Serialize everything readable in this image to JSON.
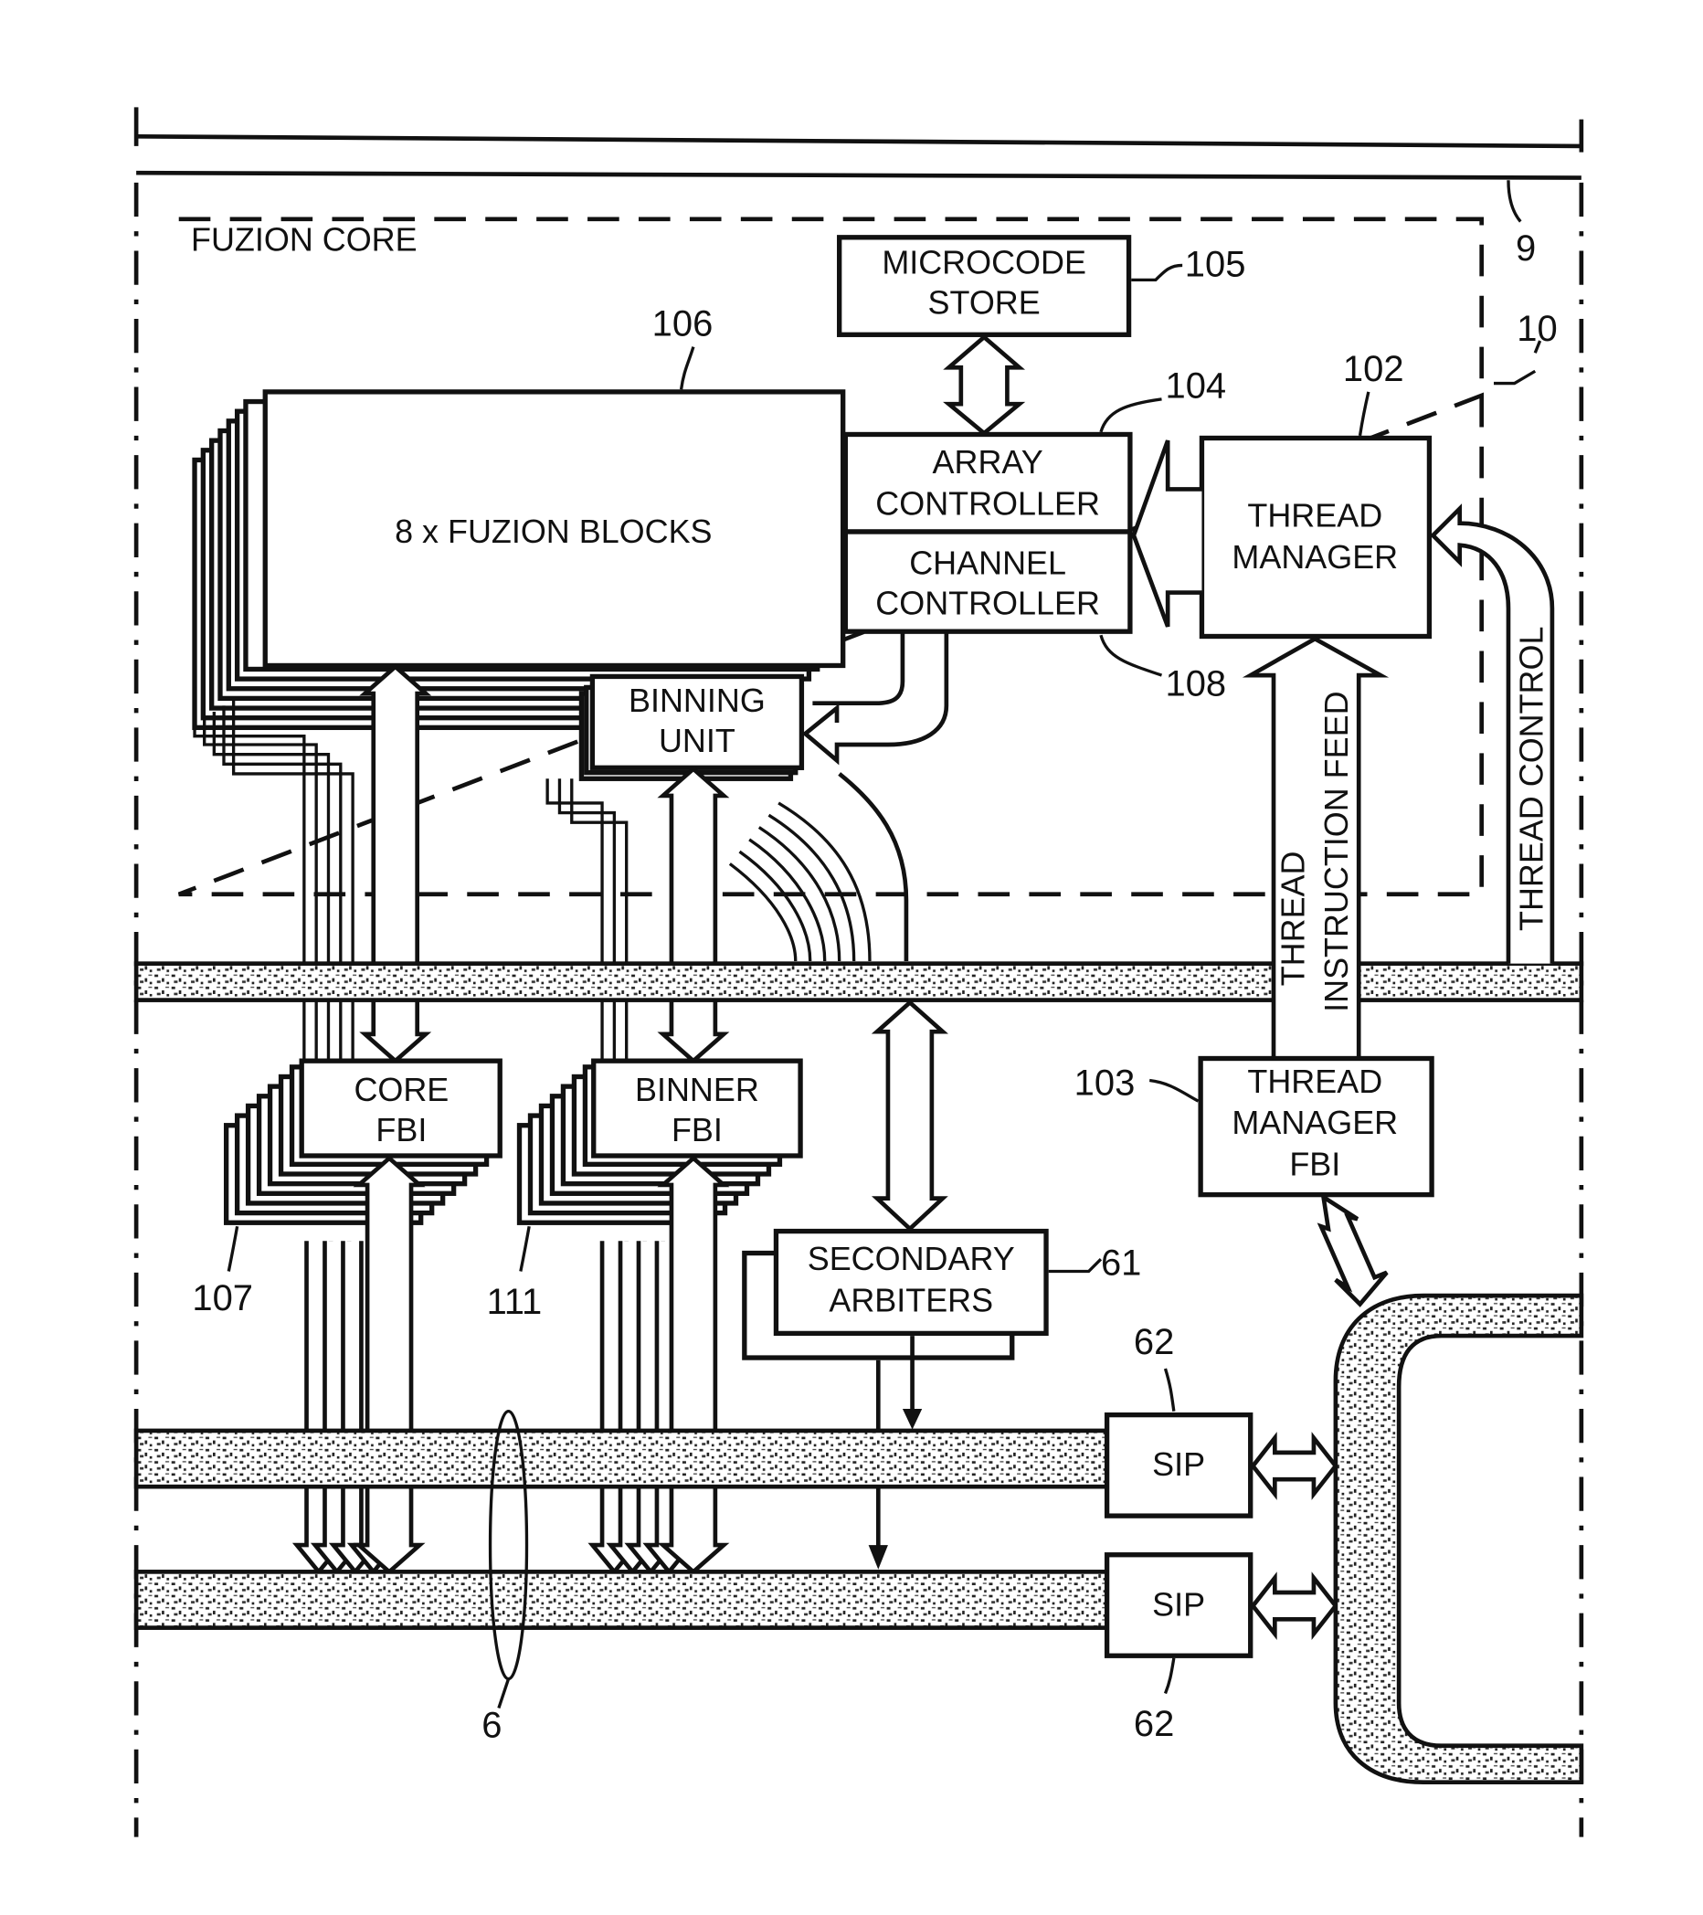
{
  "figure": {
    "region_labels": {
      "core": "FUZION CORE"
    },
    "blocks": {
      "microcode_store": [
        "MICROCODE",
        "STORE"
      ],
      "fuzion_blocks": "8 x FUZION BLOCKS",
      "array_controller": [
        "ARRAY",
        "CONTROLLER"
      ],
      "channel_controller": [
        "CHANNEL",
        "CONTROLLER"
      ],
      "thread_manager": [
        "THREAD",
        "MANAGER"
      ],
      "binning_unit": [
        "BINNING",
        "UNIT"
      ],
      "core_fbi": [
        "CORE",
        "FBI"
      ],
      "binner_fbi": [
        "BINNER",
        "FBI"
      ],
      "thread_manager_fbi": [
        "THREAD",
        "MANAGER",
        "FBI"
      ],
      "secondary_arbiters": [
        "SECONDARY",
        "ARBITERS"
      ],
      "sip_top": "SIP",
      "sip_bottom": "SIP"
    },
    "arrow_labels": {
      "thread_instruction_feed": [
        "THREAD",
        "INSTRUCTION FEED"
      ],
      "thread_control": "THREAD CONTROL"
    },
    "reference_numerals": {
      "r105": "105",
      "r106": "106",
      "r104": "104",
      "r102": "102",
      "r9": "9",
      "r10": "10",
      "r108": "108",
      "r103": "103",
      "r107": "107",
      "r111": "111",
      "r61": "61",
      "r62_top": "62",
      "r62_bottom": "62",
      "r6": "6"
    }
  }
}
